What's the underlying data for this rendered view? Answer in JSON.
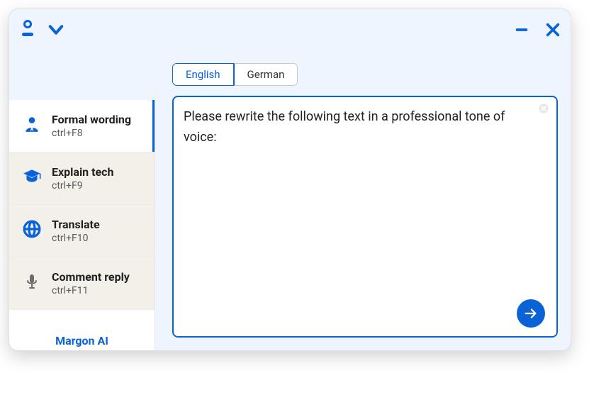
{
  "titlebar": {
    "user_icon": "user-underline",
    "dropdown_icon": "chevron-down",
    "minimize_icon": "minimize",
    "close_icon": "close"
  },
  "language_tabs": [
    {
      "label": "English",
      "active": true
    },
    {
      "label": "German",
      "active": false
    }
  ],
  "editor": {
    "value": "Please rewrite the following text in a professional tone of voice:"
  },
  "sidebar": {
    "items": [
      {
        "icon": "person-icon",
        "label": "Formal wording",
        "shortcut": "ctrl+F8",
        "active": true
      },
      {
        "icon": "graduation-cap-icon",
        "label": "Explain tech",
        "shortcut": "ctrl+F9",
        "active": false
      },
      {
        "icon": "globe-icon",
        "label": "Translate",
        "shortcut": "ctrl+F10",
        "active": false
      },
      {
        "icon": "microphone-icon",
        "label": "Comment reply",
        "shortcut": "ctrl+F11",
        "active": false
      }
    ]
  },
  "brand": "Margon AI",
  "colors": {
    "accent": "#0a63d6"
  }
}
